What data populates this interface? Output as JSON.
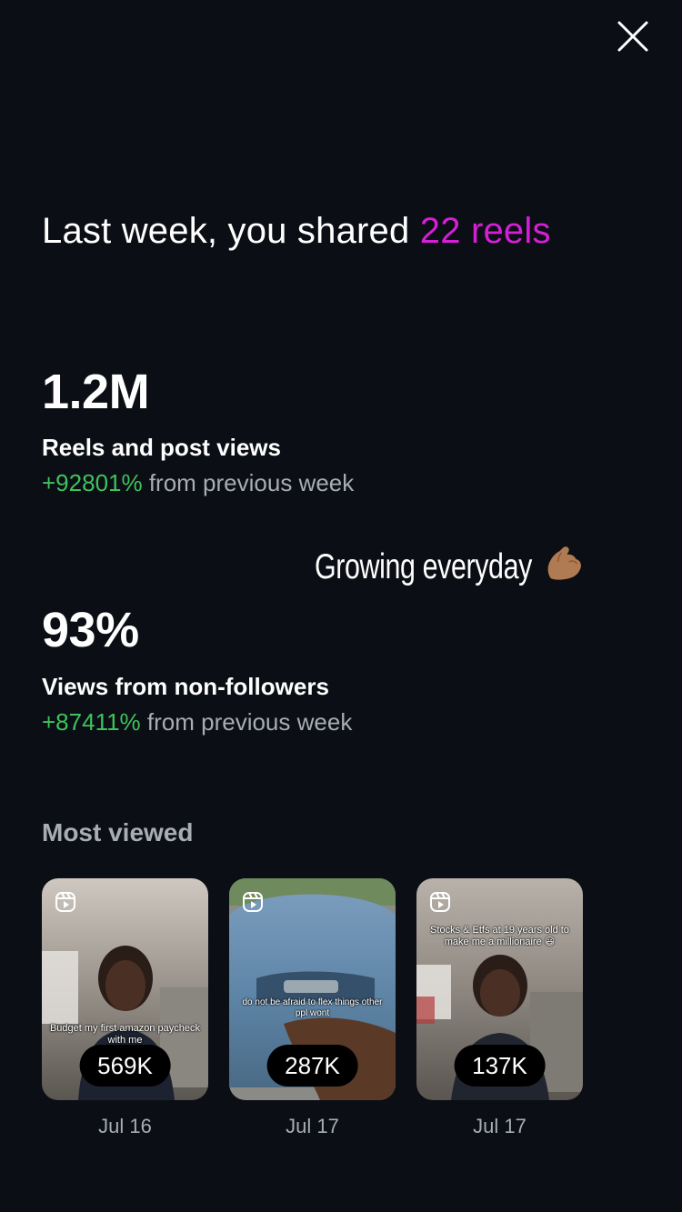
{
  "headline": {
    "prefix": "Last week, you shared ",
    "accent": "22 reels"
  },
  "stats": [
    {
      "value": "1.2M",
      "label": "Reels and post views",
      "change_pct": "+92801%",
      "change_suffix": " from previous week"
    },
    {
      "value": "93%",
      "label": "Views from non-followers",
      "change_pct": "+87411%",
      "change_suffix": " from previous week"
    }
  ],
  "sticker": {
    "text": "Growing everyday",
    "emoji_icon": "flexed-biceps-icon"
  },
  "most_viewed": {
    "title": "Most viewed",
    "reels": [
      {
        "caption": "Budget my first amazon paycheck with me",
        "views": "569K",
        "date": "Jul 16"
      },
      {
        "caption": "do not be afraid to flex things other ppl wont",
        "views": "287K",
        "date": "Jul 17"
      },
      {
        "caption": "Stocks & Etfs at 19 years old to make me a millionaire 😃",
        "views": "137K",
        "date": "Jul 17"
      }
    ]
  },
  "colors": {
    "background": "#0b0e14",
    "accent": "#d51fd6",
    "positive": "#3fc25d",
    "muted": "#a8acb4"
  }
}
